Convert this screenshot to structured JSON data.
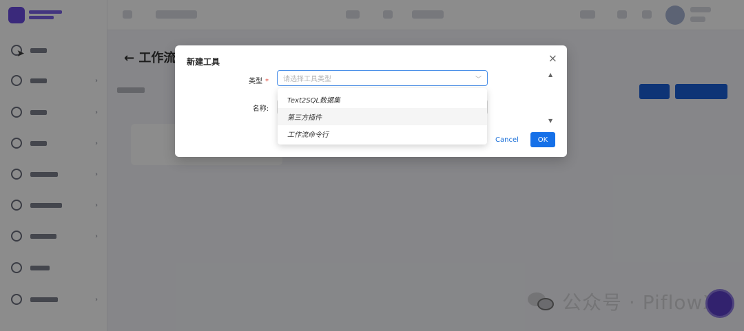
{
  "modal": {
    "title": "新建工具",
    "close_icon": "×",
    "type_label": "类型",
    "type_required_mark": "*",
    "type_placeholder": "请选择工具类型",
    "name_label": "名称:",
    "cancel_label": "Cancel",
    "ok_label": "OK"
  },
  "dropdown": {
    "options": [
      "Text2SQL数据集",
      "第三方插件",
      "工作流命令行"
    ],
    "hovered_index": 1
  },
  "background": {
    "page_title": "工作流"
  },
  "watermark": {
    "text": "公众号 · PiflowX"
  },
  "colors": {
    "primary": "#1570e8",
    "required": "#e0483a",
    "brand": "#6a4be0"
  }
}
